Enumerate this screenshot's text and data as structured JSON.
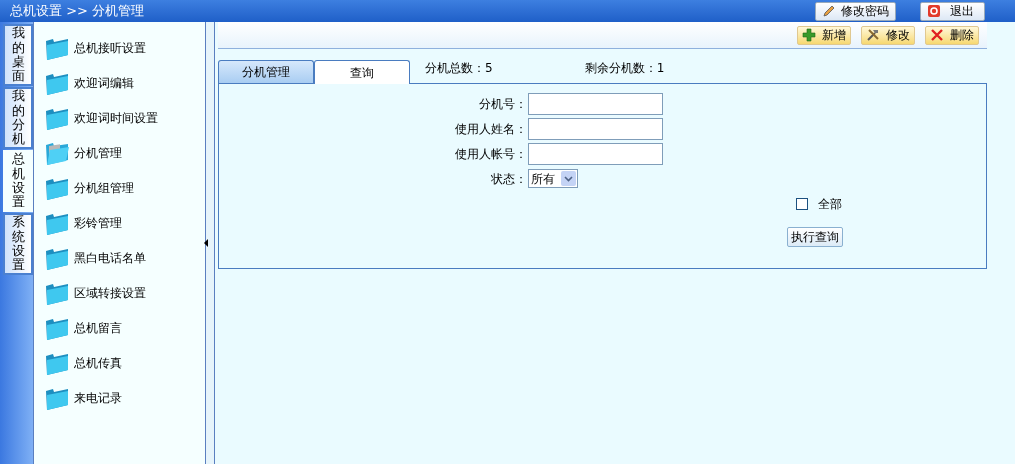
{
  "breadcrumb": "总机设置 >> 分机管理",
  "header_buttons": [
    {
      "kind": "password",
      "label": "修改密码"
    },
    {
      "kind": "logout",
      "label": "退出"
    }
  ],
  "side_tabs": [
    {
      "label": "我的桌面",
      "selected": false
    },
    {
      "label": "我的分机",
      "selected": false
    },
    {
      "label": "总机设置",
      "selected": true
    },
    {
      "label": "系统设置",
      "selected": false
    }
  ],
  "menu": [
    {
      "label": "总机接听设置",
      "selected": false
    },
    {
      "label": "欢迎词编辑",
      "selected": false
    },
    {
      "label": "欢迎词时间设置",
      "selected": false
    },
    {
      "label": "分机管理",
      "selected": true
    },
    {
      "label": "分机组管理",
      "selected": false
    },
    {
      "label": "彩铃管理",
      "selected": false
    },
    {
      "label": "黑白电话名单",
      "selected": false
    },
    {
      "label": "区域转接设置",
      "selected": false
    },
    {
      "label": "总机留言",
      "selected": false
    },
    {
      "label": "总机传真",
      "selected": false
    },
    {
      "label": "来电记录",
      "selected": false
    }
  ],
  "toolbar": [
    {
      "kind": "add",
      "label": "新增"
    },
    {
      "kind": "edit",
      "label": "修改"
    },
    {
      "kind": "delete",
      "label": "删除"
    }
  ],
  "tabs": [
    {
      "label": "分机管理",
      "selected": false
    },
    {
      "label": "查询",
      "selected": true
    }
  ],
  "stats": [
    "分机总数：5",
    "剩余分机数：1"
  ],
  "form": {
    "fields": [
      {
        "kind": "text",
        "label": "分机号："
      },
      {
        "kind": "text",
        "label": "使用人姓名："
      },
      {
        "kind": "text",
        "label": "使用人帐号："
      },
      {
        "kind": "select",
        "label": "状态：",
        "value": "所有"
      }
    ],
    "checkbox": {
      "label": "全部",
      "checked": false
    },
    "submit": "执行查询"
  }
}
